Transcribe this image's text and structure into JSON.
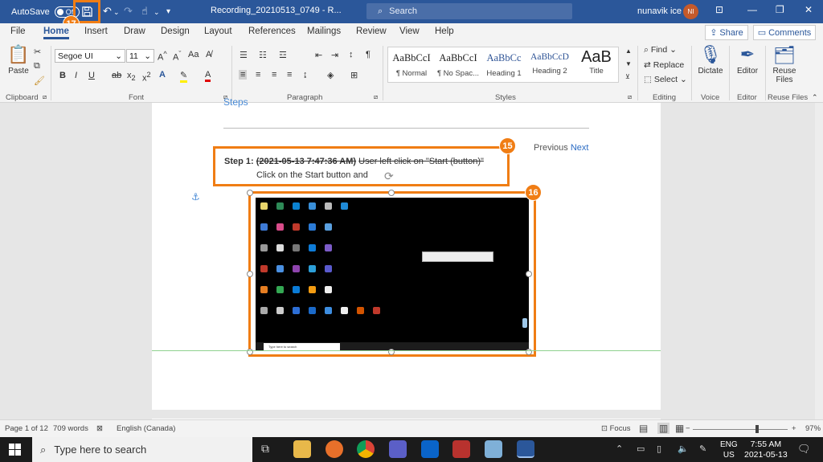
{
  "titlebar": {
    "autosave_label": "AutoSave",
    "autosave_state": "Off",
    "document_title": "Recording_20210513_0749  -  R...",
    "search_placeholder": "Search",
    "user_name": "nunavik ice",
    "user_initials": "NI"
  },
  "tabs": [
    "File",
    "Home",
    "Insert",
    "Draw",
    "Design",
    "Layout",
    "References",
    "Mailings",
    "Review",
    "View",
    "Help"
  ],
  "active_tab": "Home",
  "share_label": "Share",
  "comments_label": "Comments",
  "ribbon": {
    "clipboard": {
      "paste_label": "Paste",
      "group_label": "Clipboard"
    },
    "font": {
      "font_name": "Segoe UI",
      "font_size": "11",
      "group_label": "Font"
    },
    "paragraph": {
      "group_label": "Paragraph"
    },
    "styles": {
      "group_label": "Styles",
      "items": [
        {
          "preview": "AaBbCcI",
          "name": "¶ Normal"
        },
        {
          "preview": "AaBbCcI",
          "name": "¶ No Spac..."
        },
        {
          "preview": "AaBbCc",
          "name": "Heading 1"
        },
        {
          "preview": "AaBbCcD",
          "name": "Heading 2"
        },
        {
          "preview": "AaB",
          "name": "Title"
        }
      ]
    },
    "editing": {
      "find": "Find",
      "replace": "Replace",
      "select": "Select",
      "group_label": "Editing"
    },
    "voice": {
      "dictate": "Dictate",
      "group_label": "Voice"
    },
    "editor": {
      "editor": "Editor",
      "group_label": "Editor"
    },
    "reuse": {
      "label_line1": "Reuse",
      "label_line2": "Files",
      "group_label": "Reuse Files"
    }
  },
  "document": {
    "heading": "Steps",
    "previous": "Previous",
    "next": "Next",
    "step_prefix": "Step 1:",
    "step_timestamp": "(2021-05-13 7:47:36 AM)",
    "step_action": "User left click on \"Start (button)\"",
    "step_description": "Click on the Start button and",
    "mini_search": "Type here to search"
  },
  "badges": {
    "save": "17",
    "step": "15",
    "screenshot": "16"
  },
  "statusbar": {
    "page": "Page 1 of 12",
    "words": "709 words",
    "language": "English (Canada)",
    "focus": "Focus",
    "zoom": "97%"
  },
  "taskbar": {
    "search_placeholder": "Type here to search",
    "lang_line1": "ENG",
    "lang_line2": "US",
    "time": "7:55 AM",
    "date": "2021-05-13"
  },
  "colors": {
    "word_blue": "#2b579a",
    "highlight_orange": "#f07d14"
  }
}
